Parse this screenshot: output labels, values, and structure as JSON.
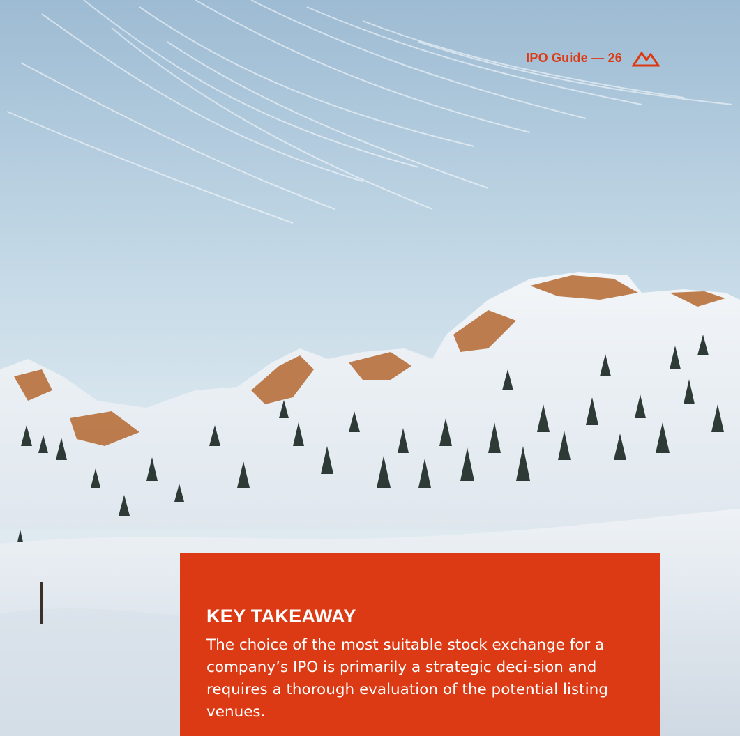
{
  "header": {
    "page_label": "IPO Guide — 26",
    "logo_icon": "mountain-outline-icon"
  },
  "takeaway": {
    "title": "KEY TAKEAWAY",
    "body": "The choice of the most suitable stock exchange for a company’s IPO is primarily a strategic deci-sion and requires a thorough evaluation of the potential listing venues."
  },
  "colors": {
    "accent": "#dc3a14",
    "text_on_accent": "#ffffff"
  }
}
